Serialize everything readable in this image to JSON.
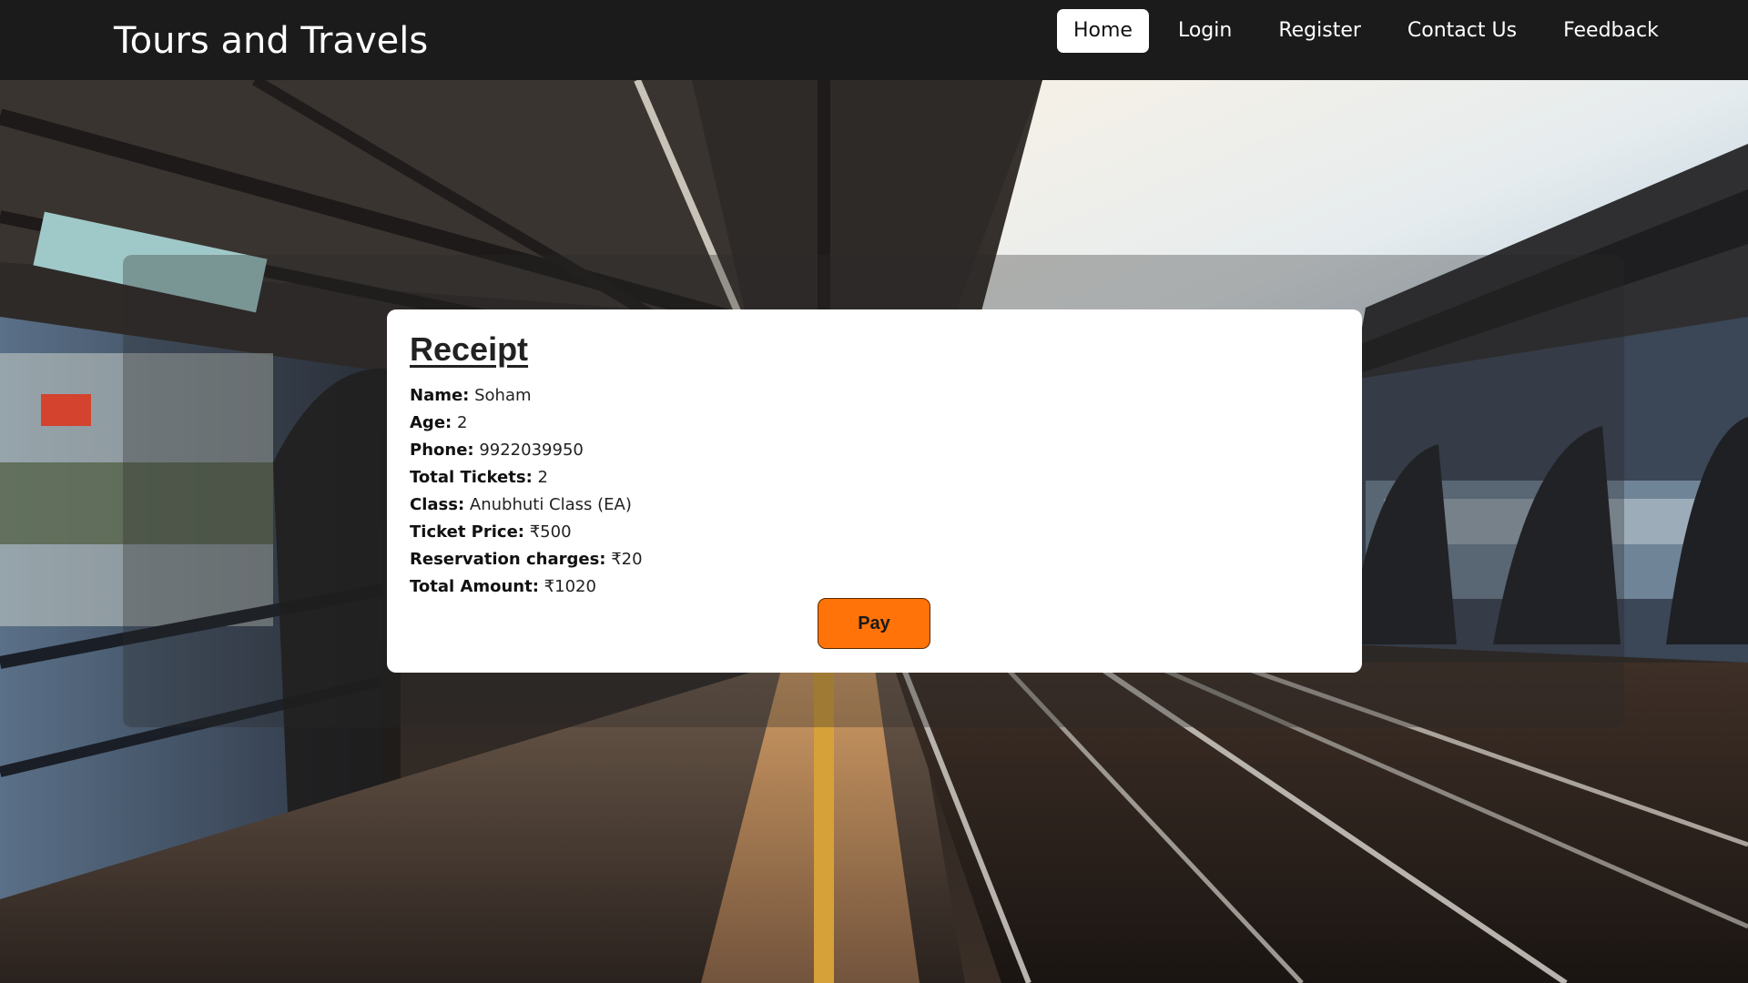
{
  "header": {
    "brand": "Tours and Travels",
    "nav": [
      {
        "label": "Home",
        "active": true
      },
      {
        "label": "Login",
        "active": false
      },
      {
        "label": "Register",
        "active": false
      },
      {
        "label": "Contact Us",
        "active": false
      },
      {
        "label": "Feedback",
        "active": false
      }
    ]
  },
  "receipt": {
    "title": "Receipt",
    "rows": [
      {
        "label": "Name:",
        "value": "Soham"
      },
      {
        "label": "Age:",
        "value": "2"
      },
      {
        "label": "Phone:",
        "value": "9922039950"
      },
      {
        "label": "Total Tickets:",
        "value": "2"
      },
      {
        "label": "Class:",
        "value": "Anubhuti Class (EA)"
      },
      {
        "label": "Ticket Price:",
        "value": "₹500"
      },
      {
        "label": "Reservation charges:",
        "value": "₹20"
      },
      {
        "label": "Total Amount:",
        "value": "₹1020"
      }
    ],
    "pay_label": "Pay"
  },
  "colors": {
    "navbar": "#1b1b1b",
    "pay_button": "#ff7308",
    "card": "#ffffff"
  },
  "background": {
    "subject": "elevated train station platform at sunset"
  }
}
